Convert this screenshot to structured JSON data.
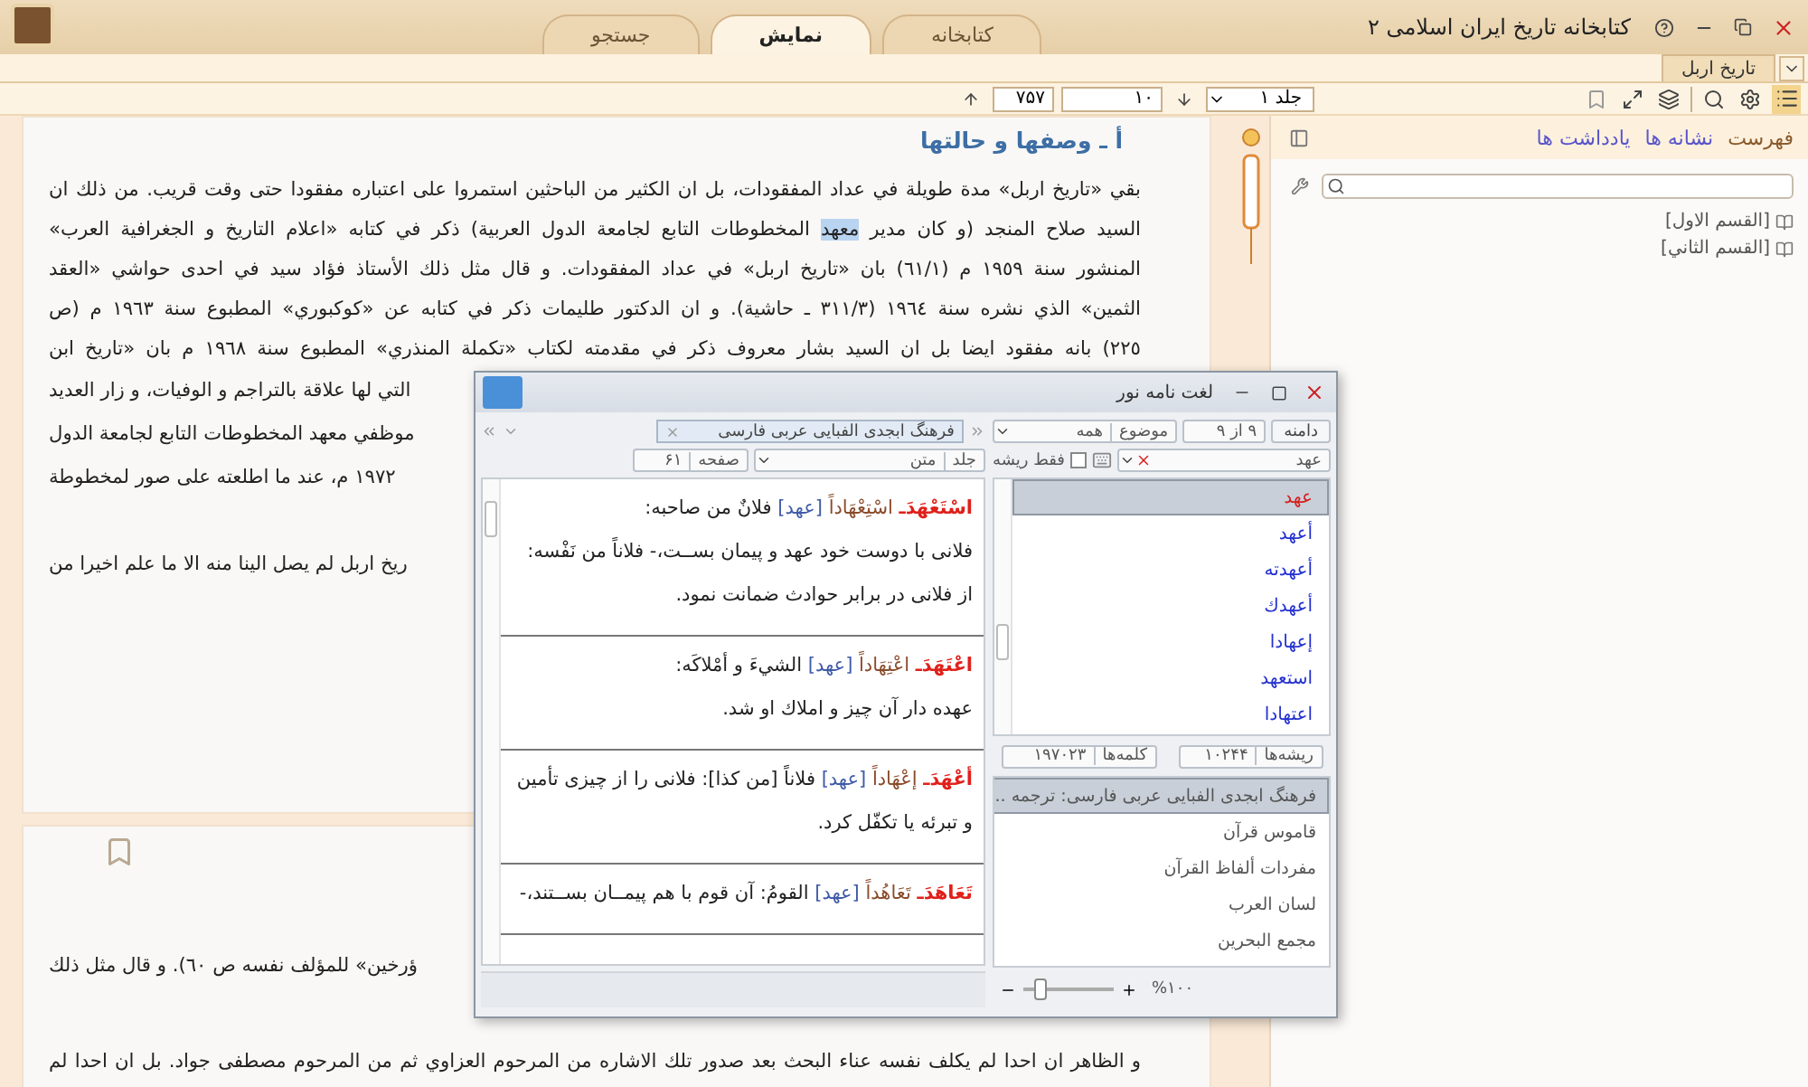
{
  "window": {
    "title": "کتابخانه تاریخ ایران اسلامی ۲"
  },
  "main_tabs": [
    {
      "label": "کتابخانه",
      "selected": false
    },
    {
      "label": "نمایش",
      "selected": true
    },
    {
      "label": "جستجو",
      "selected": false
    }
  ],
  "document_tabs": [
    {
      "label": "تاریخ اربل",
      "selected": true
    }
  ],
  "toolbar": {
    "volume": "جلد ۱",
    "page": "۱۰",
    "total_pages": "۷۵۷"
  },
  "sidebar": {
    "tabs": [
      {
        "label": "فهرست",
        "selected": true
      },
      {
        "label": "نشانه ها",
        "selected": false
      },
      {
        "label": "یادداشت ها",
        "selected": false
      }
    ],
    "tree": [
      {
        "label": "[القسم الاول]"
      },
      {
        "label": "[القسم الثاني]"
      }
    ]
  },
  "document": {
    "heading": "أ ـ وصفها و حالتها",
    "lines": [
      {
        "text": "بقي «تاريخ اربل» مدة طويلة في عداد المفقودات، بل ان الكثير من الباحثين استمروا على اعتباره مفقودا حتى وقت قريب. من ذلك ان"
      },
      {
        "parts": [
          {
            "text": "السيد صلاح المنجد (و كان مدير ",
            "highlighted": false
          },
          {
            "text": "معهد",
            "highlighted": true
          },
          {
            "text": " المخطوطات التابع لجامعة الدول العربية) ذكر في كتابه «اعلام التاريخ و الجغرافية العرب»",
            "highlighted": false
          }
        ]
      },
      {
        "text": "المنشور سنة ١٩٥٩ م (٦١/١) بان «تاريخ اربل» في عداد المفقودات. و قال مثل ذلك الأستاذ فؤاد سيد في احدى حواشي «العقد"
      },
      {
        "text": "الثمين» الذي نشره سنة ١٩٦٤ (٣١١/٣ ـ حاشية). و ان الدكتور طليمات ذكر في كتابه عن «كوكبوري» المطبوع سنة ١٩٦٣ م (ص"
      },
      {
        "text": "٢٢٥) بانه مفقود ايضا بل ان السيد بشار معروف ذكر في مقدمته لكتاب «تكملة المنذري» المطبوع سنة ١٩٦٨ م بان «تاريخ ابن"
      }
    ],
    "partial_lines": [
      "التي لها علاقة بالتراجم و الوفيات، و زار العديد",
      "موظفي معهد المخطوطات التابع لجامعة الدول",
      "١٩٧٢ م، عند ما اطلعته على صور لمخطوطة",
      "ريخ اربل لم يصل الينا منه الا ما علم اخيرا من"
    ]
  },
  "next_page": {
    "partial_lines": [
      "ؤرخين» للمؤلف نفسه ص ٦٠). و قال مثل ذلك"
    ],
    "lines": [
      "و الظاهر ان احدا لم يكلف نفسه عناء البحث بعد صدور تلك الاشاره من المرحوم العزاوي ثم من المرحوم مصطفى جواد. بل ان احدا لم"
    ]
  },
  "dictionary": {
    "title": "لغت نامه نور",
    "source_tab": "فرهنگ ابجدی الفبایی عربی  فارسی",
    "volume_label": "جلد",
    "view": "متن",
    "page_label": "صفحه",
    "page": "۶۱",
    "entries": [
      {
        "headword": "اسْتَعْهَدَـ",
        "form": "اسْتِعْهَاداً",
        "root": "[عهد]",
        "text": "فلانٌ من صاحبه:",
        "meaning": "فلانى با دوست خود عهد و پیمان بســت،- فلاناً من نَفْسه: از فلانى در برابر حوادث ضمانت نمود."
      },
      {
        "headword": "اعْتَهَدَـ",
        "form": "اعْتِهَاداً",
        "root": "[عهد]",
        "text": "الشيءَ و أمْلاكَه:",
        "meaning": "عهده دار آن چیز و املاك او شد."
      },
      {
        "headword": "أعْهَدَـ",
        "form": "إعْهَاداً",
        "root": "[عهد]",
        "text": "فلاناً [من كذا]: فلانى را از چیزى تأمین و تبرئه يا تكفّل كرد."
      },
      {
        "headword": "تَعَاهَدَـ",
        "form": "تَعَاهُداً",
        "root": "[عهد]",
        "text": "القومُ: آن قوم با هم پیمــان بســتند،-"
      }
    ],
    "scope_button": "دامنه",
    "result_count": "۹ از ۹",
    "topic_label": "موضوع",
    "topic": "همه",
    "query": "عهد",
    "root_only": {
      "label": "فقط ریشه",
      "checked": false
    },
    "words": [
      {
        "text": "عهد",
        "selected": true
      },
      {
        "text": "أعهد",
        "selected": false
      },
      {
        "text": "أعهدته",
        "selected": false
      },
      {
        "text": "أعهدك",
        "selected": false
      },
      {
        "text": "إعهادا",
        "selected": false
      },
      {
        "text": "استعهد",
        "selected": false
      },
      {
        "text": "اعتهادا",
        "selected": false
      }
    ],
    "roots_label": "ریشه‌ها",
    "roots_count": "۱۰۲۴۴",
    "words_label": "کلمه‌ها",
    "words_count": "۱۹۷۰۲۳",
    "sources": [
      {
        "label": "فرهنگ ابجدی الفبایی عربی  فارسی: ترجمه ...",
        "selected": true
      },
      {
        "label": "قاموس قرآن",
        "selected": false
      },
      {
        "label": "مفردات ألفاظ القرآن",
        "selected": false
      },
      {
        "label": "لسان العرب",
        "selected": false
      },
      {
        "label": "مجمع البحرين",
        "selected": false
      }
    ],
    "zoom": {
      "level": 0.2,
      "reading": "%۱۰۰"
    }
  }
}
